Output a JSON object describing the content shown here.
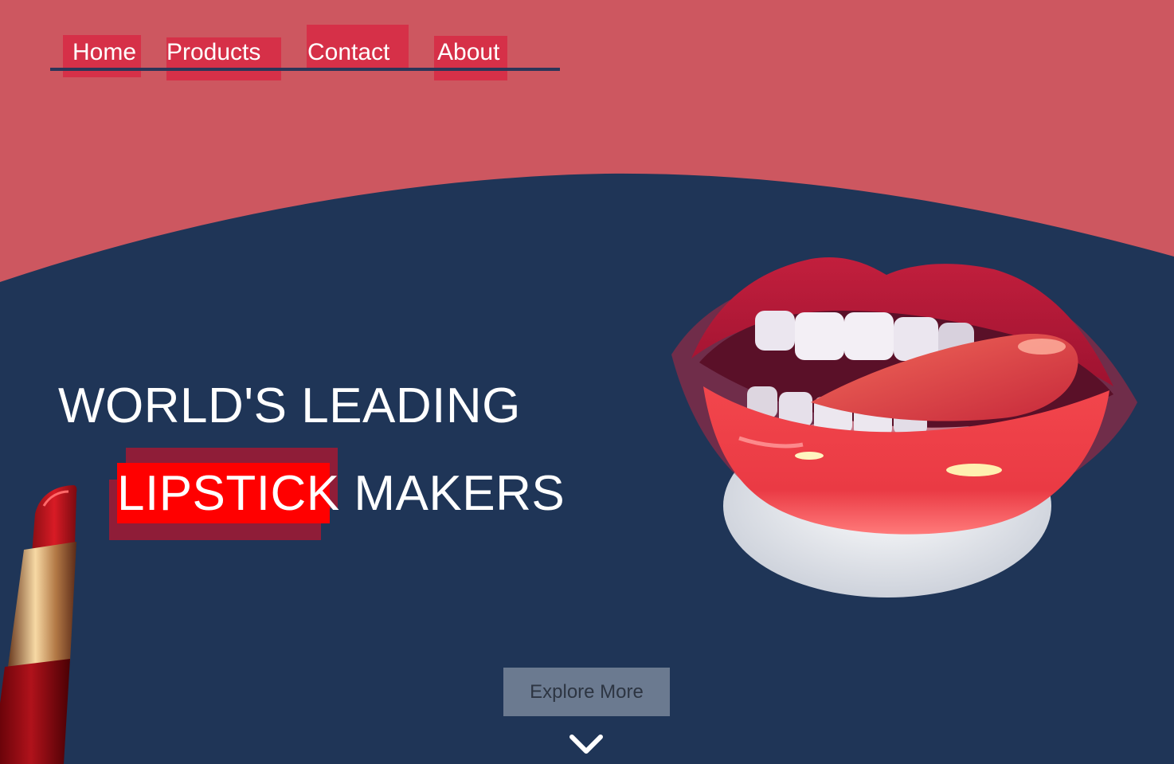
{
  "nav": {
    "items": [
      {
        "label": "Home"
      },
      {
        "label": "Products"
      },
      {
        "label": "Contact"
      },
      {
        "label": "About"
      }
    ]
  },
  "hero": {
    "headline_line1": "WORLD'S LEADING",
    "headline_highlight": "LIPSTICK",
    "headline_rest": " MAKERS",
    "cta_label": "Explore More"
  },
  "colors": {
    "top_band": "#cd5760",
    "hero_bg": "#1f3557",
    "nav_highlight": "#d63048",
    "word_highlight": "#ff0000",
    "cta_bg": "#6b7a90"
  },
  "icons": {
    "scroll_down": "chevron-down-icon",
    "lips": "lips-illustration",
    "lipstick": "lipstick-illustration"
  }
}
